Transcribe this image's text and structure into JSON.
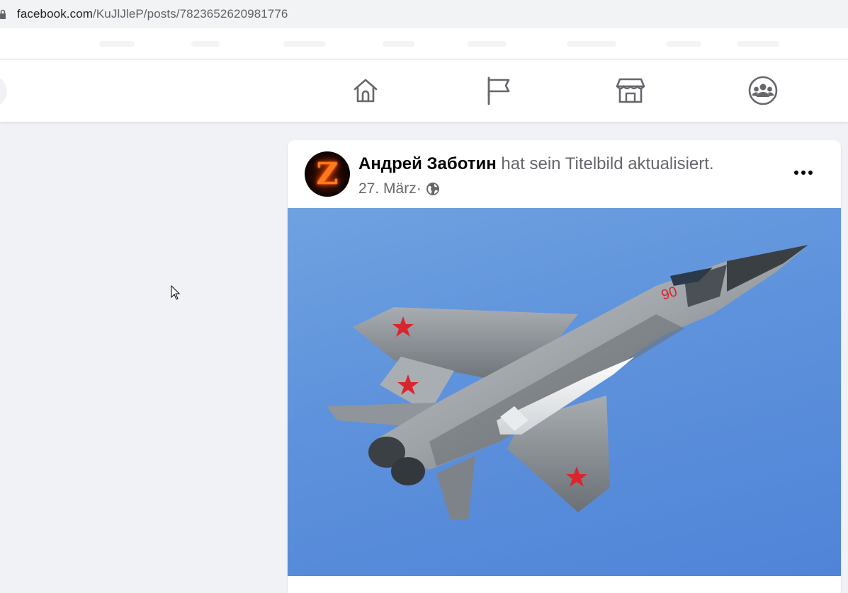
{
  "browser": {
    "url_host": "facebook.com",
    "url_path": "/KuJlJleP/posts/7823652620981776"
  },
  "header": {
    "nav": [
      {
        "icon": "home-icon"
      },
      {
        "icon": "pages-flag-icon"
      },
      {
        "icon": "marketplace-icon"
      },
      {
        "icon": "groups-icon"
      }
    ]
  },
  "post": {
    "author": "Андрей Заботин",
    "action": " hat sein Titelbild aktualisiert.",
    "date": "27. März",
    "separator": " · ",
    "visibility_icon": "globe-icon",
    "avatar_letter": "Z",
    "image_marking": "90"
  },
  "colors": {
    "page_bg": "#f0f2f5",
    "card_bg": "#ffffff",
    "sky": "#5f93dc",
    "secondary_text": "#65676b"
  }
}
